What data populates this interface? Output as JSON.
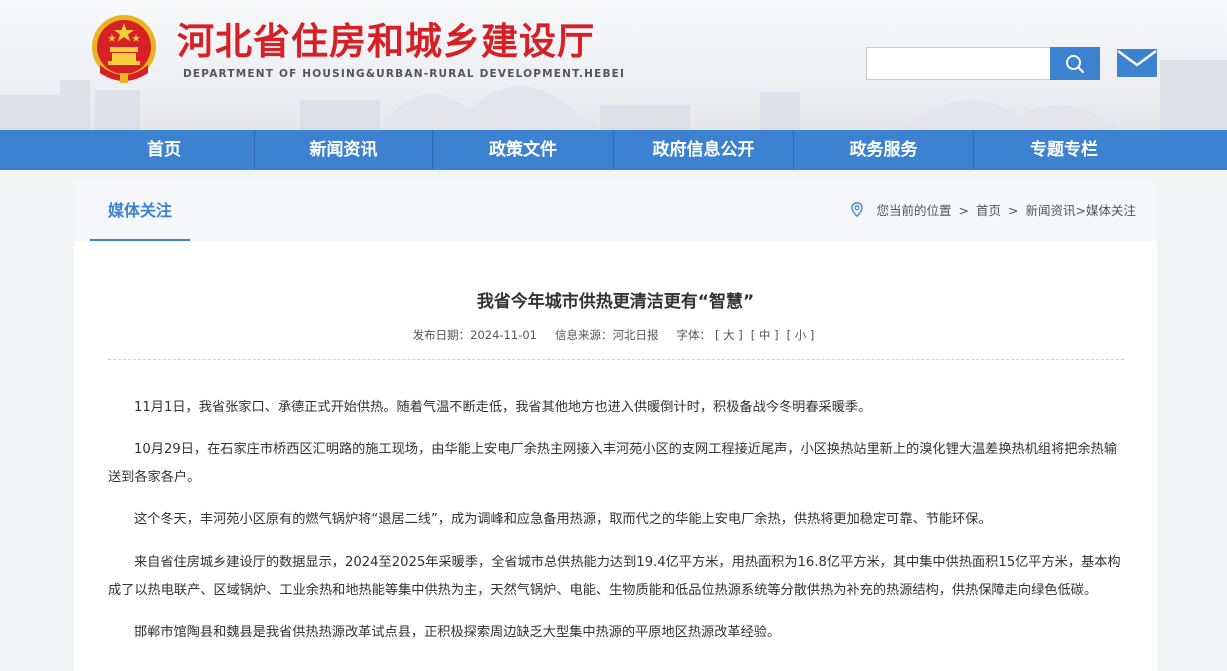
{
  "site": {
    "title": "河北省住房和城乡建设厅",
    "subtitle": "DEPARTMENT OF HOUSING&URBAN-RURAL DEVELOPMENT.HEBEI"
  },
  "search": {
    "value": "",
    "placeholder": ""
  },
  "nav": {
    "items": [
      {
        "label": "首页"
      },
      {
        "label": "新闻资讯"
      },
      {
        "label": "政策文件"
      },
      {
        "label": "政府信息公开"
      },
      {
        "label": "政务服务"
      },
      {
        "label": "专题专栏"
      }
    ]
  },
  "section": {
    "title": "媒体关注"
  },
  "breadcrumb": {
    "prefix": "您当前的位置",
    "items": [
      "首页",
      "新闻资讯>媒体关注"
    ]
  },
  "article": {
    "title": "我省今年城市供热更清洁更有“智慧”",
    "date_label": "发布日期：",
    "date": "2024-11-01",
    "source_label": "信息来源：",
    "source": "河北日报",
    "font_label": "字体：",
    "font_large": "[ 大 ]",
    "font_medium": "[ 中 ]",
    "font_small": "[ 小 ]",
    "paragraphs": [
      "11月1日，我省张家口、承德正式开始供热。随着气温不断走低，我省其他地方也进入供暖倒计时，积极备战今冬明春采暖季。",
      "10月29日，在石家庄市桥西区汇明路的施工现场，由华能上安电厂余热主网接入丰河苑小区的支网工程接近尾声，小区换热站里新上的溴化锂大温差换热机组将把余热输送到各家各户。",
      "这个冬天，丰河苑小区原有的燃气锅炉将“退居二线”，成为调峰和应急备用热源，取而代之的华能上安电厂余热，供热将更加稳定可靠、节能环保。",
      "来自省住房城乡建设厅的数据显示，2024至2025年采暖季，全省城市总供热能力达到19.4亿平方米，用热面积为16.8亿平方米，其中集中供热面积15亿平方米，基本构成了以热电联产、区域锅炉、工业余热和地热能等集中供热为主，天然气锅炉、电能、生物质能和低品位热源系统等分散供热为补充的热源结构，供热保障走向绿色低碳。",
      "邯郸市馆陶县和魏县是我省供热热源改革试点县，正积极探索周边缺乏大型集中热源的平原地区热源改革经验。"
    ]
  },
  "colors": {
    "brand_red": "#d71f26",
    "nav_blue": "#3c82d0",
    "emblem_gold": "#e9b51e"
  },
  "icons": [
    "national-emblem-icon",
    "search-icon",
    "mail-icon",
    "location-pin-icon"
  ]
}
